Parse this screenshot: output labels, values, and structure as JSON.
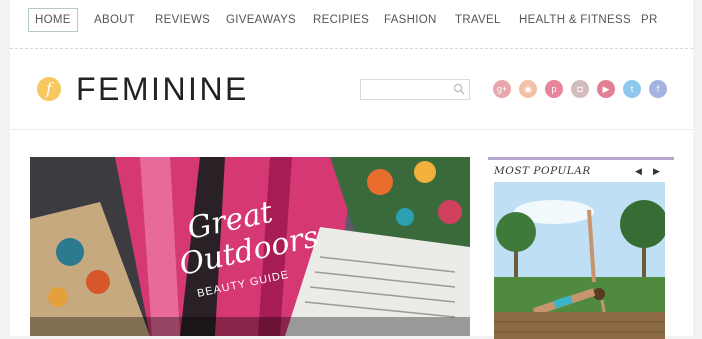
{
  "nav": {
    "items": [
      {
        "label": "HOME"
      },
      {
        "label": "ABOUT"
      },
      {
        "label": "REVIEWS"
      },
      {
        "label": "GIVEAWAYS"
      },
      {
        "label": "RECIPIES"
      },
      {
        "label": "FASHION"
      },
      {
        "label": "TRAVEL"
      },
      {
        "label": "HEALTH & FITNESS"
      },
      {
        "label": "PR"
      }
    ]
  },
  "header": {
    "logo_letter": "f",
    "site_name": "FEMININE",
    "search_icon": "search-icon"
  },
  "social": [
    {
      "icon": "google-plus-icon",
      "glyph": "g+",
      "color": "#e8a7ad"
    },
    {
      "icon": "rss-icon",
      "glyph": "◉",
      "color": "#f3c1a7"
    },
    {
      "icon": "pinterest-icon",
      "glyph": "p",
      "color": "#e7859b"
    },
    {
      "icon": "instagram-icon",
      "glyph": "◘",
      "color": "#d3bcbc"
    },
    {
      "icon": "youtube-icon",
      "glyph": "▶",
      "color": "#e37f93"
    },
    {
      "icon": "twitter-icon",
      "glyph": "t",
      "color": "#8ec8ec"
    },
    {
      "icon": "facebook-icon",
      "glyph": "f",
      "color": "#a4b3df"
    }
  ],
  "hero": {
    "image_text_line1": "Great",
    "image_text_line2": "Outdoors",
    "image_text_line3": "BEAUTY GUIDE"
  },
  "sidebar": {
    "title": "MOST POPULAR",
    "prev": "◀",
    "next": "▶",
    "accent": "#b3a7cf"
  }
}
